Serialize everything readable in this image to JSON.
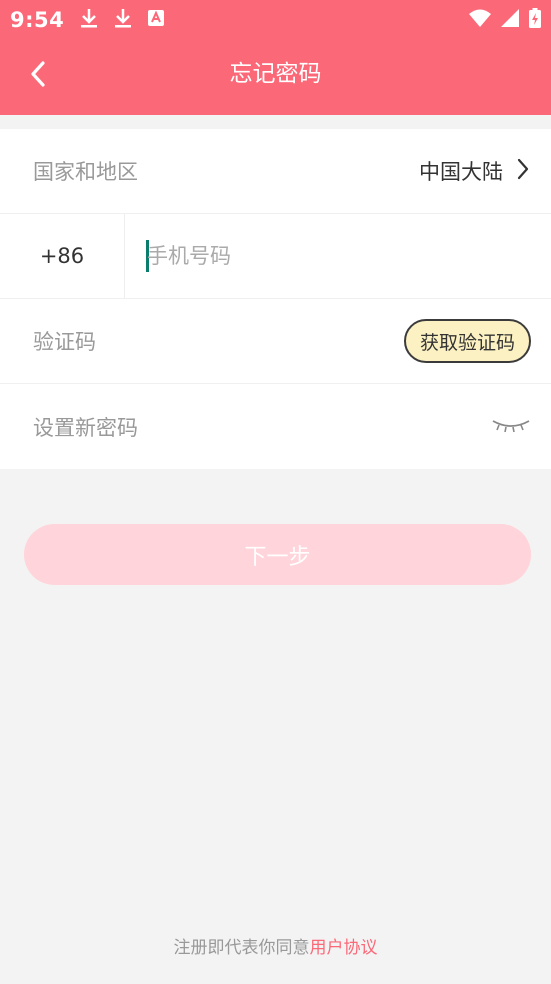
{
  "status_bar": {
    "time": "9:54",
    "icons": [
      "download-icon",
      "download-icon",
      "app-notification-icon",
      "wifi-icon",
      "signal-icon",
      "battery-icon"
    ]
  },
  "nav": {
    "title": "忘记密码",
    "back_icon": "back-arrow-icon"
  },
  "form": {
    "region": {
      "label": "国家和地区",
      "value": "中国大陆",
      "icon": "chevron-right-icon"
    },
    "phone": {
      "country_code": "+86",
      "placeholder": "手机号码",
      "value": ""
    },
    "verification": {
      "label": "验证码",
      "button_label": "获取验证码"
    },
    "password": {
      "label": "设置新密码",
      "icon": "eye-closed-icon"
    }
  },
  "next_button_label": "下一步",
  "footer": {
    "text": "注册即代表你同意",
    "link": "用户协议"
  },
  "colors": {
    "primary": "#fb6878",
    "next_button_disabled": "#ffd4da",
    "code_button_bg": "#fcf1c2",
    "background": "#f3f3f3"
  }
}
